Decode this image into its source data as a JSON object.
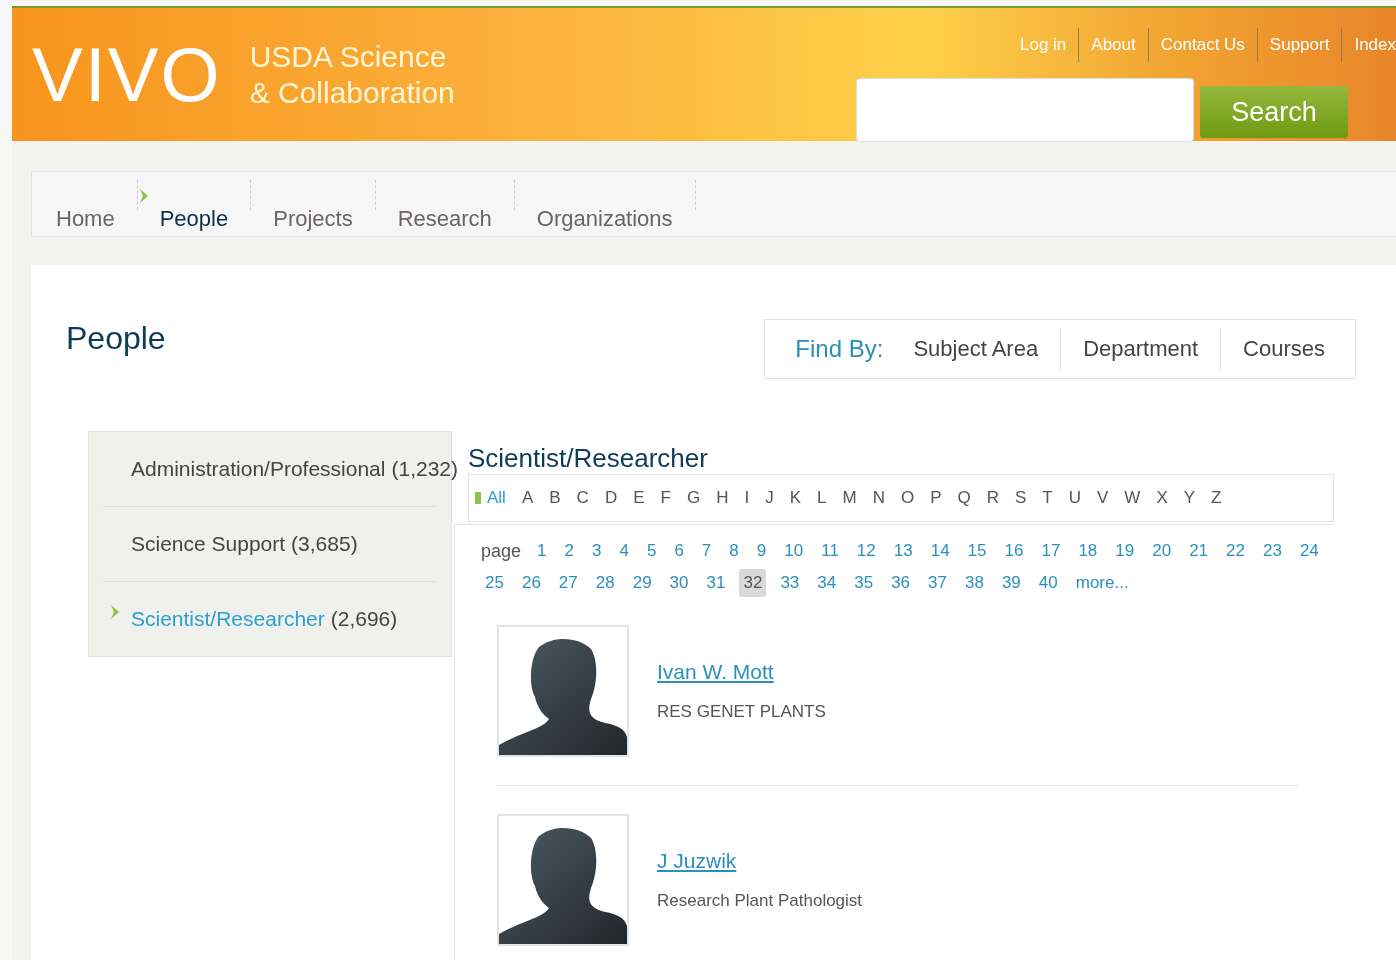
{
  "header": {
    "logo": "VIVO",
    "subtitle": [
      "USDA Science",
      "& Collaboration"
    ],
    "top_links": [
      "Log in",
      "About",
      "Contact Us",
      "Support",
      "Index"
    ],
    "search": {
      "button": "Search"
    }
  },
  "nav": {
    "items": [
      {
        "label": "Home",
        "selected": false
      },
      {
        "label": "People",
        "selected": true
      },
      {
        "label": "Projects",
        "selected": false
      },
      {
        "label": "Research",
        "selected": false
      },
      {
        "label": "Organizations",
        "selected": false
      }
    ]
  },
  "page_title": "People",
  "find_by": {
    "label": "Find By:",
    "options": [
      "Subject Area",
      "Department",
      "Courses"
    ]
  },
  "sidebar": {
    "items": [
      {
        "label": "Administration/Professional",
        "count": "(1,232)",
        "selected": false
      },
      {
        "label": "Science Support",
        "count": "(3,685)",
        "selected": false
      },
      {
        "label": "Scientist/Researcher",
        "count": "(2,696)",
        "selected": true
      }
    ]
  },
  "content": {
    "title": "Scientist/Researcher",
    "alphabet": [
      {
        "label": "All",
        "selected": true
      },
      {
        "label": "A",
        "selected": false
      },
      {
        "label": "B",
        "selected": false
      },
      {
        "label": "C",
        "selected": false
      },
      {
        "label": "D",
        "selected": false
      },
      {
        "label": "E",
        "selected": false
      },
      {
        "label": "F",
        "selected": false
      },
      {
        "label": "G",
        "selected": false
      },
      {
        "label": "H",
        "selected": false
      },
      {
        "label": "I",
        "selected": false
      },
      {
        "label": "J",
        "selected": false
      },
      {
        "label": "K",
        "selected": false
      },
      {
        "label": "L",
        "selected": false
      },
      {
        "label": "M",
        "selected": false
      },
      {
        "label": "N",
        "selected": false
      },
      {
        "label": "O",
        "selected": false
      },
      {
        "label": "P",
        "selected": false
      },
      {
        "label": "Q",
        "selected": false
      },
      {
        "label": "R",
        "selected": false
      },
      {
        "label": "S",
        "selected": false
      },
      {
        "label": "T",
        "selected": false
      },
      {
        "label": "U",
        "selected": false
      },
      {
        "label": "V",
        "selected": false
      },
      {
        "label": "W",
        "selected": false
      },
      {
        "label": "X",
        "selected": false
      },
      {
        "label": "Y",
        "selected": false
      },
      {
        "label": "Z",
        "selected": false
      }
    ],
    "pages": {
      "label": "page",
      "more": "more...",
      "items": [
        {
          "label": "1",
          "selected": false
        },
        {
          "label": "2",
          "selected": false
        },
        {
          "label": "3",
          "selected": false
        },
        {
          "label": "4",
          "selected": false
        },
        {
          "label": "5",
          "selected": false
        },
        {
          "label": "6",
          "selected": false
        },
        {
          "label": "7",
          "selected": false
        },
        {
          "label": "8",
          "selected": false
        },
        {
          "label": "9",
          "selected": false
        },
        {
          "label": "10",
          "selected": false
        },
        {
          "label": "11",
          "selected": false
        },
        {
          "label": "12",
          "selected": false
        },
        {
          "label": "13",
          "selected": false
        },
        {
          "label": "14",
          "selected": false
        },
        {
          "label": "15",
          "selected": false
        },
        {
          "label": "16",
          "selected": false
        },
        {
          "label": "17",
          "selected": false
        },
        {
          "label": "18",
          "selected": false
        },
        {
          "label": "19",
          "selected": false
        },
        {
          "label": "20",
          "selected": false
        },
        {
          "label": "21",
          "selected": false
        },
        {
          "label": "22",
          "selected": false
        },
        {
          "label": "23",
          "selected": false
        },
        {
          "label": "24",
          "selected": false
        },
        {
          "label": "25",
          "selected": false
        },
        {
          "label": "26",
          "selected": false
        },
        {
          "label": "27",
          "selected": false
        },
        {
          "label": "28",
          "selected": false
        },
        {
          "label": "29",
          "selected": false
        },
        {
          "label": "30",
          "selected": false
        },
        {
          "label": "31",
          "selected": false
        },
        {
          "label": "32",
          "selected": true
        },
        {
          "label": "33",
          "selected": false
        },
        {
          "label": "34",
          "selected": false
        },
        {
          "label": "35",
          "selected": false
        },
        {
          "label": "36",
          "selected": false
        },
        {
          "label": "37",
          "selected": false
        },
        {
          "label": "38",
          "selected": false
        },
        {
          "label": "39",
          "selected": false
        },
        {
          "label": "40",
          "selected": false
        }
      ]
    },
    "people": [
      {
        "name": "Ivan W. Mott",
        "title": "RES GENET PLANTS"
      },
      {
        "name": "J Juzwik",
        "title": "Research Plant Pathologist"
      }
    ]
  }
}
